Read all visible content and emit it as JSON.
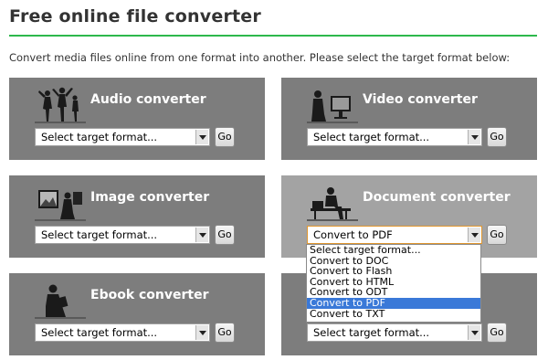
{
  "page": {
    "title": "Free online file converter",
    "intro": "Convert media files online from one format into another. Please select the target format below:"
  },
  "converters": {
    "audio": {
      "heading": "Audio converter",
      "selected": "Select target format...",
      "go": "Go",
      "icon": "people-dancing-icon"
    },
    "video": {
      "heading": "Video converter",
      "selected": "Select target format...",
      "go": "Go",
      "icon": "person-watching-screen-icon"
    },
    "image": {
      "heading": "Image converter",
      "selected": "Select target format...",
      "go": "Go",
      "icon": "framed-picture-icon"
    },
    "document": {
      "heading": "Document converter",
      "selected": "Convert to PDF",
      "go": "Go",
      "icon": "person-at-desk-icon"
    },
    "ebook": {
      "heading": "Ebook converter",
      "selected": "Select target format...",
      "go": "Go",
      "icon": "person-reading-icon"
    },
    "hidden": {
      "selected": "Select target format...",
      "go": "Go"
    }
  },
  "document_dropdown": {
    "options": [
      "Select target format...",
      "Convert to DOC",
      "Convert to Flash",
      "Convert to HTML",
      "Convert to ODT",
      "Convert to PDF",
      "Convert to TXT"
    ],
    "highlighted": "Convert to PDF"
  },
  "colors": {
    "accent_rule": "#2db84b",
    "panel": "#7d7d7d",
    "panel_active": "#a3a3a3",
    "highlight": "#3a79d8"
  }
}
